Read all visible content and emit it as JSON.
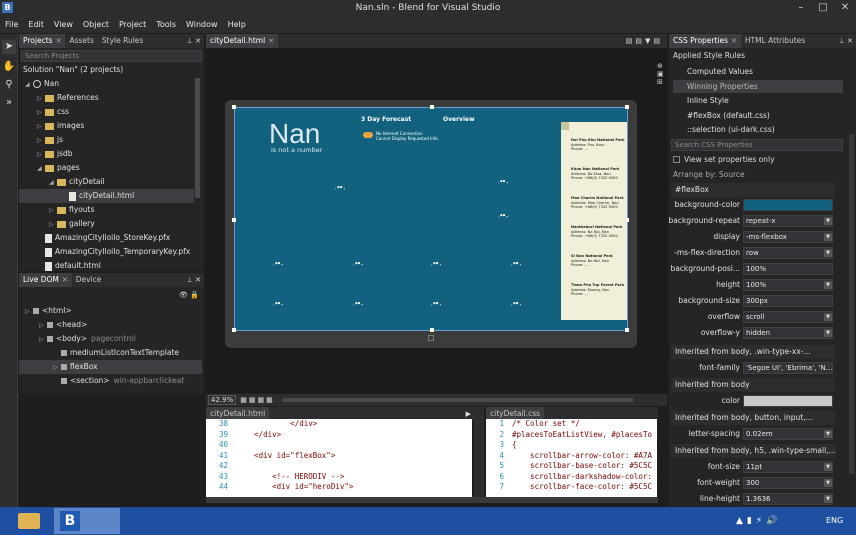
{
  "window": {
    "title": "Nan.sln - Blend for Visual Studio",
    "icon_letter": "B"
  },
  "menu": [
    "File",
    "Edit",
    "View",
    "Object",
    "Project",
    "Tools",
    "Window",
    "Help"
  ],
  "projects_panel": {
    "tabs": [
      "Projects",
      "Assets",
      "Style Rules"
    ],
    "search_placeholder": "Search Projects",
    "solution": "Solution \"Nan\" (2 projects)",
    "tree": [
      {
        "label": "Nan",
        "type": "globe",
        "depth": 0,
        "expanded": true
      },
      {
        "label": "References",
        "type": "folder",
        "depth": 1
      },
      {
        "label": "css",
        "type": "folder",
        "depth": 1
      },
      {
        "label": "images",
        "type": "folder",
        "depth": 1
      },
      {
        "label": "js",
        "type": "folder",
        "depth": 1
      },
      {
        "label": "jsdb",
        "type": "folder",
        "depth": 1
      },
      {
        "label": "pages",
        "type": "folder",
        "depth": 1,
        "expanded": true
      },
      {
        "label": "cityDetail",
        "type": "folder",
        "depth": 2,
        "expanded": true
      },
      {
        "label": "cityDetail.html",
        "type": "file",
        "depth": 3,
        "selected": true
      },
      {
        "label": "flyouts",
        "type": "folder",
        "depth": 2
      },
      {
        "label": "gallery",
        "type": "folder",
        "depth": 2
      },
      {
        "label": "AmazingCityIloilo_StoreKey.pfx",
        "type": "file",
        "depth": 1
      },
      {
        "label": "AmazingCityIloilo_TemporaryKey.pfx",
        "type": "file",
        "depth": 1
      },
      {
        "label": "default.html",
        "type": "file",
        "depth": 1
      }
    ]
  },
  "dom_panel": {
    "tabs": [
      "Live DOM",
      "Device"
    ],
    "tree": [
      {
        "label": "<html>",
        "extra": "",
        "depth": 0
      },
      {
        "label": "<head>",
        "extra": "",
        "depth": 1
      },
      {
        "label": "<body>",
        "extra": "pagecontrol",
        "depth": 1
      },
      {
        "label": "mediumListIconTextTemplate",
        "extra": "",
        "depth": 2
      },
      {
        "label": "flexBox",
        "extra": "",
        "depth": 2,
        "selected": true
      },
      {
        "label": "<section>",
        "extra": "win-appbarclickeat",
        "depth": 2
      }
    ]
  },
  "document": {
    "tab": "cityDetail.html",
    "zoom": "42.9%",
    "app": {
      "title": "Nan",
      "subtitle": "is not a number",
      "nav1": "3 Day Forecast",
      "nav2": "Overview",
      "warning1": "No Internet Connection",
      "warning2": "Cannot Display Requested Info.",
      "parks": [
        {
          "name": "Dol Phu Khu National Park",
          "l1": "Address: Puu Xuan",
          "l2": "Phone: ..."
        },
        {
          "name": "Khun Nan National Park",
          "l1": "Address: Bo Klua, Nan",
          "l2": "Phone: +66(0) 7332 0000"
        },
        {
          "name": "Mae Charim National Park",
          "l1": "Address: Mae Charim, Nan",
          "l2": "Phone: +66(0) 7332 0000"
        },
        {
          "name": "Nanthaburi National Park",
          "l1": "Address: Na Noi, Nan",
          "l2": "Phone: +66(0) 7332 0000"
        },
        {
          "name": "Si Nan National Park",
          "l1": "Address: Na Noi, Nan",
          "l2": "Phone: ..."
        },
        {
          "name": "Tham Pha Tup Forest Park",
          "l1": "Address: Muang, Nan",
          "l2": "Phone: ..."
        }
      ]
    }
  },
  "html_editor": {
    "tab": "cityDetail.html",
    "lines": [
      {
        "n": "38",
        "code": "            </div>"
      },
      {
        "n": "39",
        "code": "    </div>"
      },
      {
        "n": "40",
        "code": ""
      },
      {
        "n": "41",
        "code": "    <div id=\"flexBox\">"
      },
      {
        "n": "42",
        "code": ""
      },
      {
        "n": "43",
        "code": "        <!-- HERODIV -->"
      },
      {
        "n": "44",
        "code": "        <div id=\"heroDiv\">"
      }
    ]
  },
  "css_editor": {
    "tab": "cityDetail.css",
    "lines": [
      {
        "n": "1",
        "code": "/* Color set */"
      },
      {
        "n": "2",
        "code": "#placesToEatListView, #placesTo"
      },
      {
        "n": "3",
        "code": "{"
      },
      {
        "n": "4",
        "code": "    scrollbar-arrow-color: #A7A"
      },
      {
        "n": "5",
        "code": "    scrollbar-base-color: #5C5C"
      },
      {
        "n": "6",
        "code": "    scrollbar-darkshadow-color:"
      },
      {
        "n": "7",
        "code": "    scrollbar-face-color: #5C5C"
      }
    ]
  },
  "css_panel": {
    "tabs": [
      "CSS Properties",
      "HTML Attributes"
    ],
    "applied_label": "Applied Style Rules",
    "rules": [
      "Computed Values",
      "Winning Properties",
      "Inline Style",
      "#flexBox (default.css)",
      "::selection (ui-dark.css)"
    ],
    "search_placeholder": "Search CSS Properties",
    "view_set_only": "View set properties only",
    "arrange": "Arrange by: Source",
    "section_flexbox": "#flexBox",
    "props": [
      {
        "label": "background-color",
        "value": "",
        "swatch": "#11617f"
      },
      {
        "label": "background-repeat",
        "value": "repeat-x",
        "dropdown": true
      },
      {
        "label": "display",
        "value": "-ms-flexbox",
        "dropdown": true
      },
      {
        "label": "-ms-flex-direction",
        "value": "row",
        "dropdown": true
      },
      {
        "label": "background-posi...",
        "value": "100%"
      },
      {
        "label": "height",
        "value": "100%",
        "dropdown": true
      },
      {
        "label": "background-size",
        "value": "300px"
      },
      {
        "label": "overflow",
        "value": "scroll",
        "dropdown": true
      },
      {
        "label": "overflow-y",
        "value": "hidden",
        "dropdown": true
      }
    ],
    "inherited": [
      {
        "header": "Inherited from body, .win-type-xx-...",
        "rows": [
          {
            "label": "font-family",
            "value": "'Segoe UI', 'Ebrima', 'N..."
          }
        ]
      },
      {
        "header": "Inherited from body",
        "rows": [
          {
            "label": "color",
            "value": "",
            "swatch": "#c8c8c8"
          }
        ]
      },
      {
        "header": "Inherited from body, button, input,...",
        "rows": [
          {
            "label": "letter-spacing",
            "value": "0.02em",
            "dropdown": true
          }
        ]
      },
      {
        "header": "Inherited from body, h5, .win-type-small,...",
        "rows": [
          {
            "label": "font-size",
            "value": "11pt",
            "dropdown": true
          },
          {
            "label": "font-weight",
            "value": "300",
            "dropdown": true
          },
          {
            "label": "line-height",
            "value": "1.3636",
            "dropdown": true
          }
        ]
      }
    ]
  },
  "taskbar": {
    "lang": "ENG"
  },
  "colors": {
    "accent": "#11617f",
    "selection": "#3e3e42",
    "taskbar": "#1e4fa0"
  }
}
